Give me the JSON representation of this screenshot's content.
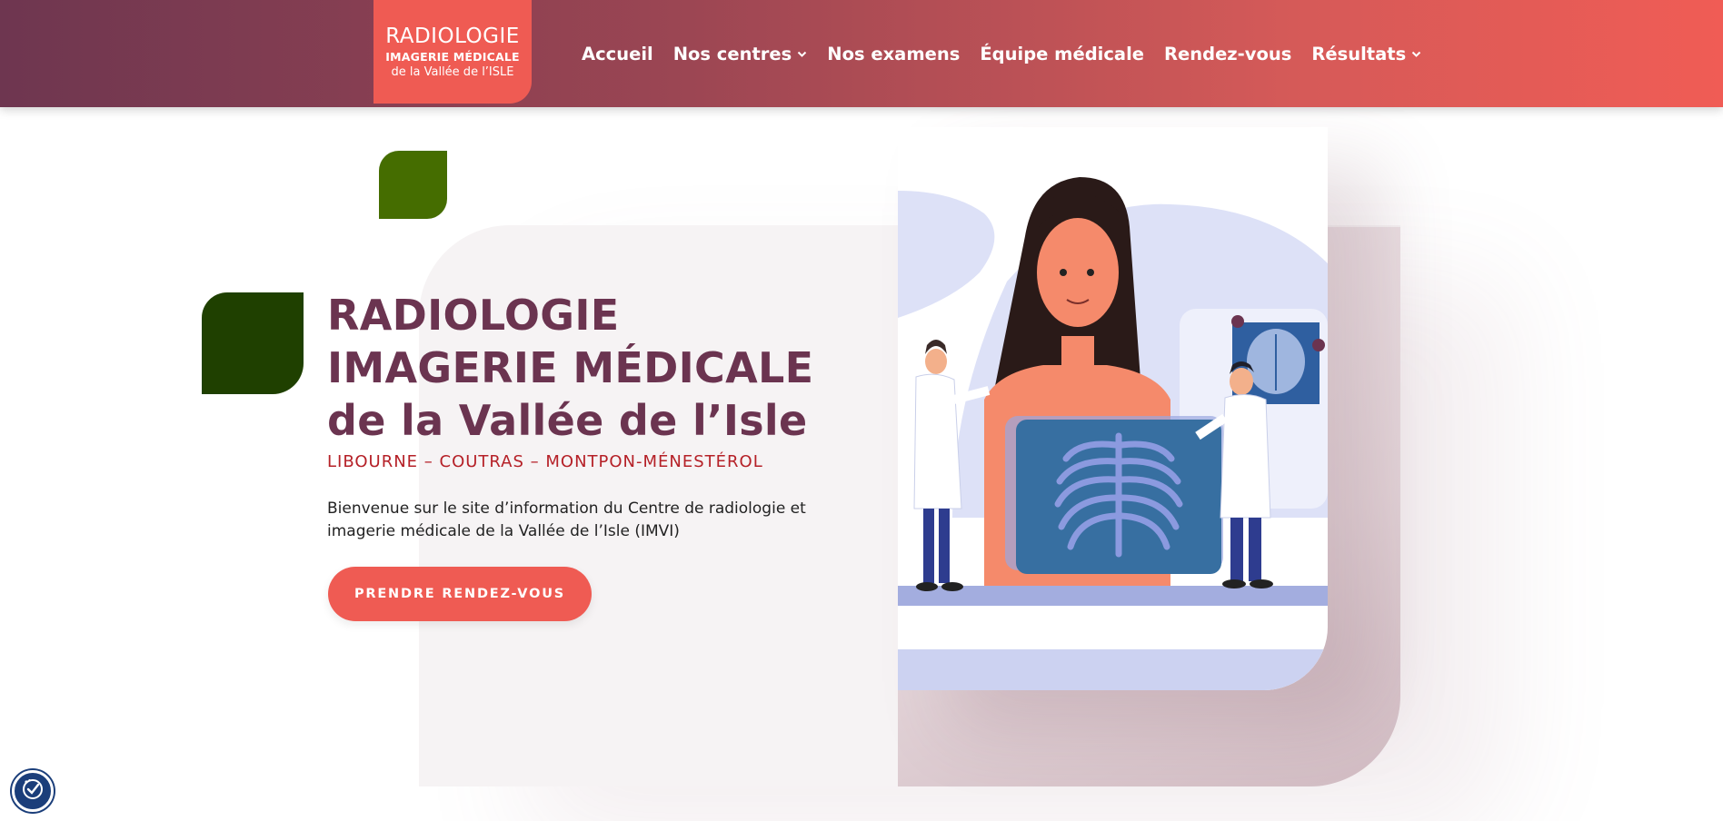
{
  "colors": {
    "header_start": "#6e3650",
    "header_end": "#f05c55",
    "accent": "#ef5b53",
    "title": "#6b3450",
    "subtitle": "#b52027",
    "leaf_light": "#456d00",
    "leaf_dark": "#1f4000"
  },
  "logo": {
    "line1": "RADIOLOGIE",
    "line2": "IMAGERIE MÉDICALE",
    "line3": "de la Vallée de l’ISLE"
  },
  "nav": {
    "items": [
      {
        "label": "Accueil",
        "dropdown": false
      },
      {
        "label": "Nos centres",
        "dropdown": true
      },
      {
        "label": "Nos examens",
        "dropdown": false
      },
      {
        "label": "Équipe médicale",
        "dropdown": false
      },
      {
        "label": "Rendez-vous",
        "dropdown": false
      },
      {
        "label": "Résultats",
        "dropdown": true
      }
    ],
    "chevron_icon": "chevron-down-icon"
  },
  "hero": {
    "title_line1": "RADIOLOGIE",
    "title_line2": "IMAGERIE MÉDICALE",
    "title_line3": "de la Vallée de l’Isle",
    "subtitle": "LIBOURNE – COUTRAS – MONTPON-MÉNESTÉROL",
    "intro": "Bienvenue sur le site d’information du Centre de radiologie et imagerie médicale de la Vallée de l’Isle (IMVI)",
    "cta_label": "PRENDRE RENDEZ-VOUS"
  },
  "illustration": {
    "icon": "radiology-xray-illustration"
  },
  "accessibility": {
    "icon": "accessibility-icon"
  }
}
